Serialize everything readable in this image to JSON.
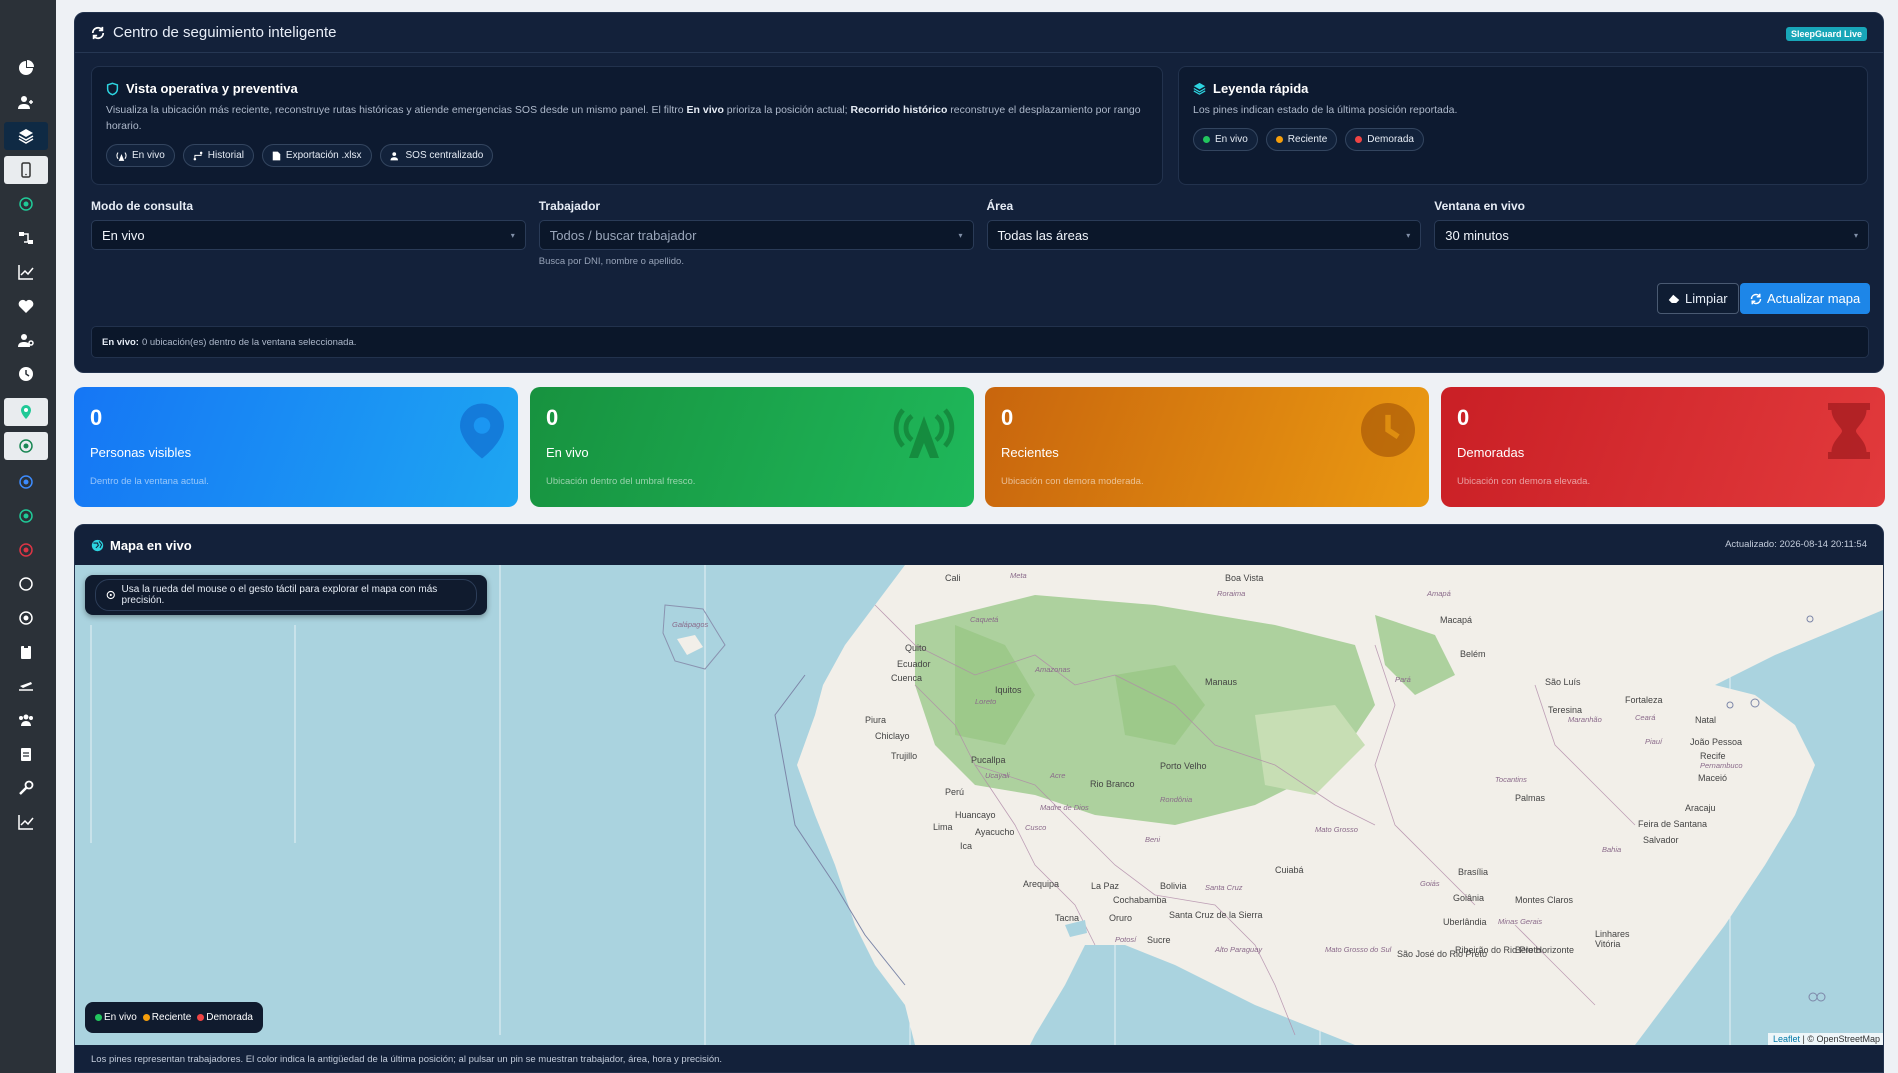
{
  "header": {
    "title": "Centro de seguimiento inteligente",
    "badge": "SleepGuard Live"
  },
  "operational": {
    "title": "Vista operativa y preventiva",
    "desc_1": "Visualiza la ubicación más reciente, reconstruye rutas históricas y atiende emergencias SOS desde un mismo panel. El filtro ",
    "desc_b1": "En vivo",
    "desc_2": " prioriza la posición actual; ",
    "desc_b2": "Recorrido histórico",
    "desc_3": " reconstruye el desplazamiento por rango horario.",
    "chips": [
      "En vivo",
      "Historial",
      "Exportación .xlsx",
      "SOS centralizado"
    ]
  },
  "legend": {
    "title": "Leyenda rápida",
    "desc": "Los pines indican estado de la última posición reportada.",
    "items": [
      "En vivo",
      "Reciente",
      "Demorada"
    ],
    "colors": {
      "live": "#22c55e",
      "recent": "#f59e0b",
      "delayed": "#ef4444"
    }
  },
  "filters": {
    "mode": {
      "label": "Modo de consulta",
      "value": "En vivo"
    },
    "worker": {
      "label": "Trabajador",
      "placeholder": "Todos / buscar trabajador",
      "help": "Busca por DNI, nombre o apellido."
    },
    "area": {
      "label": "Área",
      "value": "Todas las áreas"
    },
    "window": {
      "label": "Ventana en vivo",
      "value": "30 minutos"
    }
  },
  "actions": {
    "clear": "Limpiar",
    "update": "Actualizar mapa"
  },
  "status": {
    "bold": "En vivo:",
    "text": "0 ubicación(es) dentro de la ventana seleccionada."
  },
  "stats": [
    {
      "value": "0",
      "label": "Personas visibles",
      "sub": "Dentro de la ventana actual."
    },
    {
      "value": "0",
      "label": "En vivo",
      "sub": "Ubicación dentro del umbral fresco."
    },
    {
      "value": "0",
      "label": "Recientes",
      "sub": "Ubicación con demora moderada."
    },
    {
      "value": "0",
      "label": "Demoradas",
      "sub": "Ubicación con demora elevada."
    }
  ],
  "map": {
    "title": "Mapa en vivo",
    "updated": "Actualizado: 2026-08-14 20:11:54",
    "tooltip": "Usa la rueda del mouse o el gesto táctil para explorar el mapa con más precisión.",
    "legend": [
      "En vivo",
      "Reciente",
      "Demorada"
    ],
    "attribution_leaflet": "Leaflet",
    "attribution_osm": "| © OpenStreetMap",
    "footer": "Los pines representan trabajadores. El color indica la antigüedad de la última posición; al pulsar un pin se muestran trabajador, área, hora y precisión.",
    "places": [
      "Boa Vista",
      "Cali",
      "Macapá",
      "Quito",
      "Ecuador",
      "Cuenca",
      "Belém",
      "São Luís",
      "Manaus",
      "Iquitos",
      "Fortaleza",
      "Teresina",
      "Natal",
      "Piura",
      "Chiclayo",
      "João Pessoa",
      "Recife",
      "Trujillo",
      "Pucallpa",
      "Porto Velho",
      "Maceió",
      "Rio Branco",
      "Palmas",
      "Perú",
      "Aracaju",
      "Huancayo",
      "Feira de Santana",
      "Lima",
      "Ayacucho",
      "Salvador",
      "Ica",
      "Cuiabá",
      "Brasília",
      "Arequipa",
      "La Paz",
      "Bolivia",
      "Goiânia",
      "Montes Claros",
      "Cochabamba",
      "Tacna",
      "Oruro",
      "Santa Cruz de la Sierra",
      "Uberlândia",
      "Sucre",
      "Linhares",
      "Ribeirão do Rio Preto",
      "Belo Horizonte",
      "Vitória",
      "São José do Rio Preto",
      "Galápagos",
      "Amazonas",
      "Caquetá",
      "Loreto",
      "Ucayali",
      "Acre",
      "Rondônia",
      "Madre de Dios",
      "Beni",
      "Mato Grosso",
      "Tocantins",
      "Maranhão",
      "Ceará",
      "Piauí",
      "Pernambuco",
      "Bahia",
      "Goiás",
      "Minas Gerais",
      "Mato Grosso do Sul",
      "Pará",
      "Amapá",
      "Roraima",
      "Meta",
      "Cusco",
      "Santa Cruz",
      "Potosí",
      "Alto Paraguay"
    ]
  }
}
